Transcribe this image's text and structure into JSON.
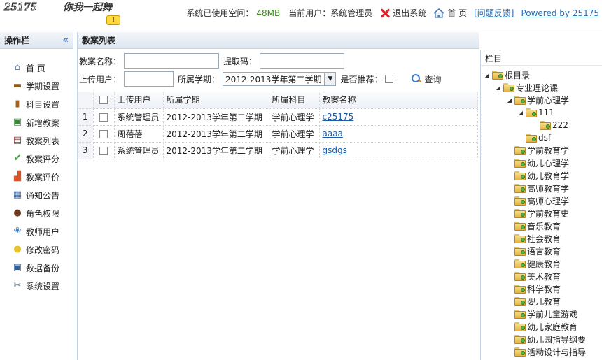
{
  "header": {
    "logo_code": "25175",
    "logo_slogan": "你我一起舞",
    "logo_bubble": "!",
    "space_label": "系统已使用空间：",
    "space_value": "48MB",
    "user_label": "当前用户：",
    "user_value": "系统管理员",
    "logout_label": "退出系统",
    "home_label": "首 页",
    "feedback_label": "[问题反馈]",
    "powered_label": "Powered by 25175"
  },
  "sidebar": {
    "title": "操作栏",
    "collapse_glyph": "«",
    "items": [
      {
        "label": "首 页",
        "icon": "home-icon",
        "glyph": "⌂",
        "color": "#5a7fb5"
      },
      {
        "label": "学期设置",
        "icon": "book-icon",
        "glyph": "▬",
        "color": "#8a5a20"
      },
      {
        "label": "科目设置",
        "icon": "books-icon",
        "glyph": "▮",
        "color": "#a5621e"
      },
      {
        "label": "新增教案",
        "icon": "add-doc-icon",
        "glyph": "▣",
        "color": "#3b8a3b"
      },
      {
        "label": "教案列表",
        "icon": "list-icon",
        "glyph": "▤",
        "color": "#8a2a2a"
      },
      {
        "label": "教案评分",
        "icon": "check-icon",
        "glyph": "✔",
        "color": "#2e9a2e"
      },
      {
        "label": "教案评价",
        "icon": "all-icon",
        "glyph": "▟",
        "color": "#d9542b"
      },
      {
        "label": "通知公告",
        "icon": "notice-icon",
        "glyph": "▦",
        "color": "#3a6fb0"
      },
      {
        "label": "角色权限",
        "icon": "user-icon",
        "glyph": "●",
        "color": "#6b3a1e"
      },
      {
        "label": "教师用户",
        "icon": "users-icon",
        "glyph": "❀",
        "color": "#3b7bbf"
      },
      {
        "label": "修改密码",
        "icon": "bulb-icon",
        "glyph": "●",
        "color": "#e6c22b"
      },
      {
        "label": "数据备份",
        "icon": "disk-icon",
        "glyph": "▣",
        "color": "#2f5f9e"
      },
      {
        "label": "系统设置",
        "icon": "tools-icon",
        "glyph": "✂",
        "color": "#6a7b8e"
      }
    ]
  },
  "main": {
    "title": "教案列表",
    "search": {
      "name_label": "教案名称：",
      "name_value": "",
      "code_label": "提取码：",
      "code_value": "",
      "uploader_label": "上传用户：",
      "uploader_value": "",
      "term_label": "所属学期：",
      "term_value": "2012-2013学年第二学期",
      "recommend_label": "是否推荐：",
      "query_label": "查询"
    },
    "table": {
      "headers": [
        "上传用户",
        "所属学期",
        "所属科目",
        "教案名称"
      ],
      "rows": [
        {
          "num": "1",
          "user": "系统管理员",
          "term": "2012-2013学年第二学期",
          "subject": "学前心理学",
          "name": "c25175"
        },
        {
          "num": "2",
          "user": "周蓓蓓",
          "term": "2012-2013学年第二学期",
          "subject": "学前心理学",
          "name": "aaaa"
        },
        {
          "num": "3",
          "user": "系统管理员",
          "term": "2012-2013学年第二学期",
          "subject": "学前心理学",
          "name": "gsdgs"
        }
      ]
    }
  },
  "tree": {
    "title": "栏目",
    "nodes": [
      {
        "label": "根目录",
        "level": 0,
        "toggle": "◢"
      },
      {
        "label": "专业理论课",
        "level": 1,
        "toggle": "◢"
      },
      {
        "label": "学前心理学",
        "level": 2,
        "toggle": "◢"
      },
      {
        "label": "111",
        "level": 3,
        "toggle": "◢"
      },
      {
        "label": "222",
        "level": 4,
        "toggle": ""
      },
      {
        "label": "dsf",
        "level": 3,
        "toggle": ""
      },
      {
        "label": "学前教育学",
        "level": 2,
        "toggle": ""
      },
      {
        "label": "幼儿心理学",
        "level": 2,
        "toggle": ""
      },
      {
        "label": "幼儿教育学",
        "level": 2,
        "toggle": ""
      },
      {
        "label": "高师教育学",
        "level": 2,
        "toggle": ""
      },
      {
        "label": "高师心理学",
        "level": 2,
        "toggle": ""
      },
      {
        "label": "学前教育史",
        "level": 2,
        "toggle": ""
      },
      {
        "label": "音乐教育",
        "level": 2,
        "toggle": ""
      },
      {
        "label": "社会教育",
        "level": 2,
        "toggle": ""
      },
      {
        "label": "语言教育",
        "level": 2,
        "toggle": ""
      },
      {
        "label": "健康教育",
        "level": 2,
        "toggle": ""
      },
      {
        "label": "美术教育",
        "level": 2,
        "toggle": ""
      },
      {
        "label": "科学教育",
        "level": 2,
        "toggle": ""
      },
      {
        "label": "婴儿教育",
        "level": 2,
        "toggle": ""
      },
      {
        "label": "学前儿童游戏",
        "level": 2,
        "toggle": ""
      },
      {
        "label": "幼儿家庭教育",
        "level": 2,
        "toggle": ""
      },
      {
        "label": "幼儿园指导纲要",
        "level": 2,
        "toggle": ""
      },
      {
        "label": "活动设计与指导",
        "level": 2,
        "toggle": ""
      }
    ]
  }
}
